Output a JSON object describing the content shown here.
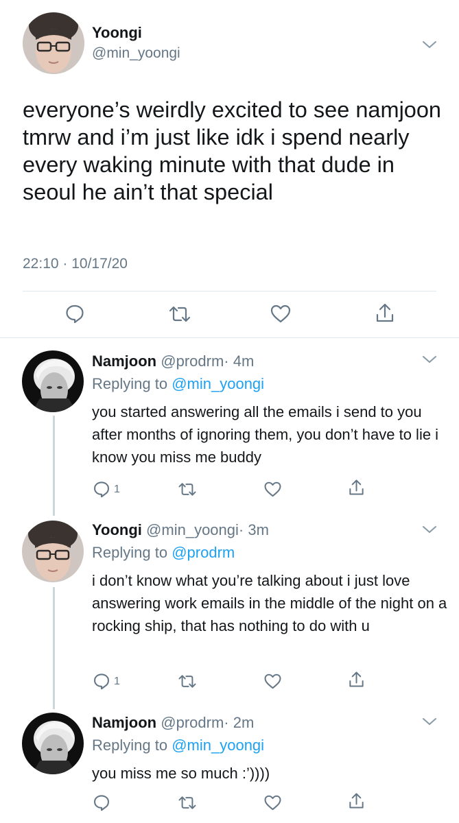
{
  "main_tweet": {
    "name": "Yoongi",
    "handle": "@min_yoongi",
    "text": "everyone’s weirdly excited to see namjoon tmrw and i’m just like idk i spend nearly every waking minute with that dude in seoul he ain’t that special",
    "timestamp": "22:10 · 10/17/20"
  },
  "replies": [
    {
      "name": "Namjoon",
      "handle": "@prodrm",
      "time": "· 4m",
      "replying_prefix": "Replying to",
      "replying_to": "@min_yoongi",
      "text": "you started answering all the emails i send to you after months of ignoring them, you don’t have to lie i know you miss me buddy",
      "reply_count": "1"
    },
    {
      "name": "Yoongi",
      "handle": "@min_yoongi",
      "time": "· 3m",
      "replying_prefix": "Replying to",
      "replying_to": "@prodrm",
      "text": "i don’t know what you’re talking about i just love answering work emails in the middle of the night on a rocking ship, that has nothing to do with u",
      "reply_count": "1"
    },
    {
      "name": "Namjoon",
      "handle": "@prodrm",
      "time": "· 2m",
      "replying_prefix": "Replying to",
      "replying_to": "@min_yoongi",
      "text": "you miss me so much :’))))",
      "reply_count": ""
    }
  ],
  "colors": {
    "text": "#14171a",
    "secondary": "#657786",
    "link": "#1da1f2",
    "divider": "#e1e8ed"
  },
  "icons": [
    "comment-icon",
    "retweet-icon",
    "like-icon",
    "share-icon",
    "chevron-down-icon"
  ]
}
